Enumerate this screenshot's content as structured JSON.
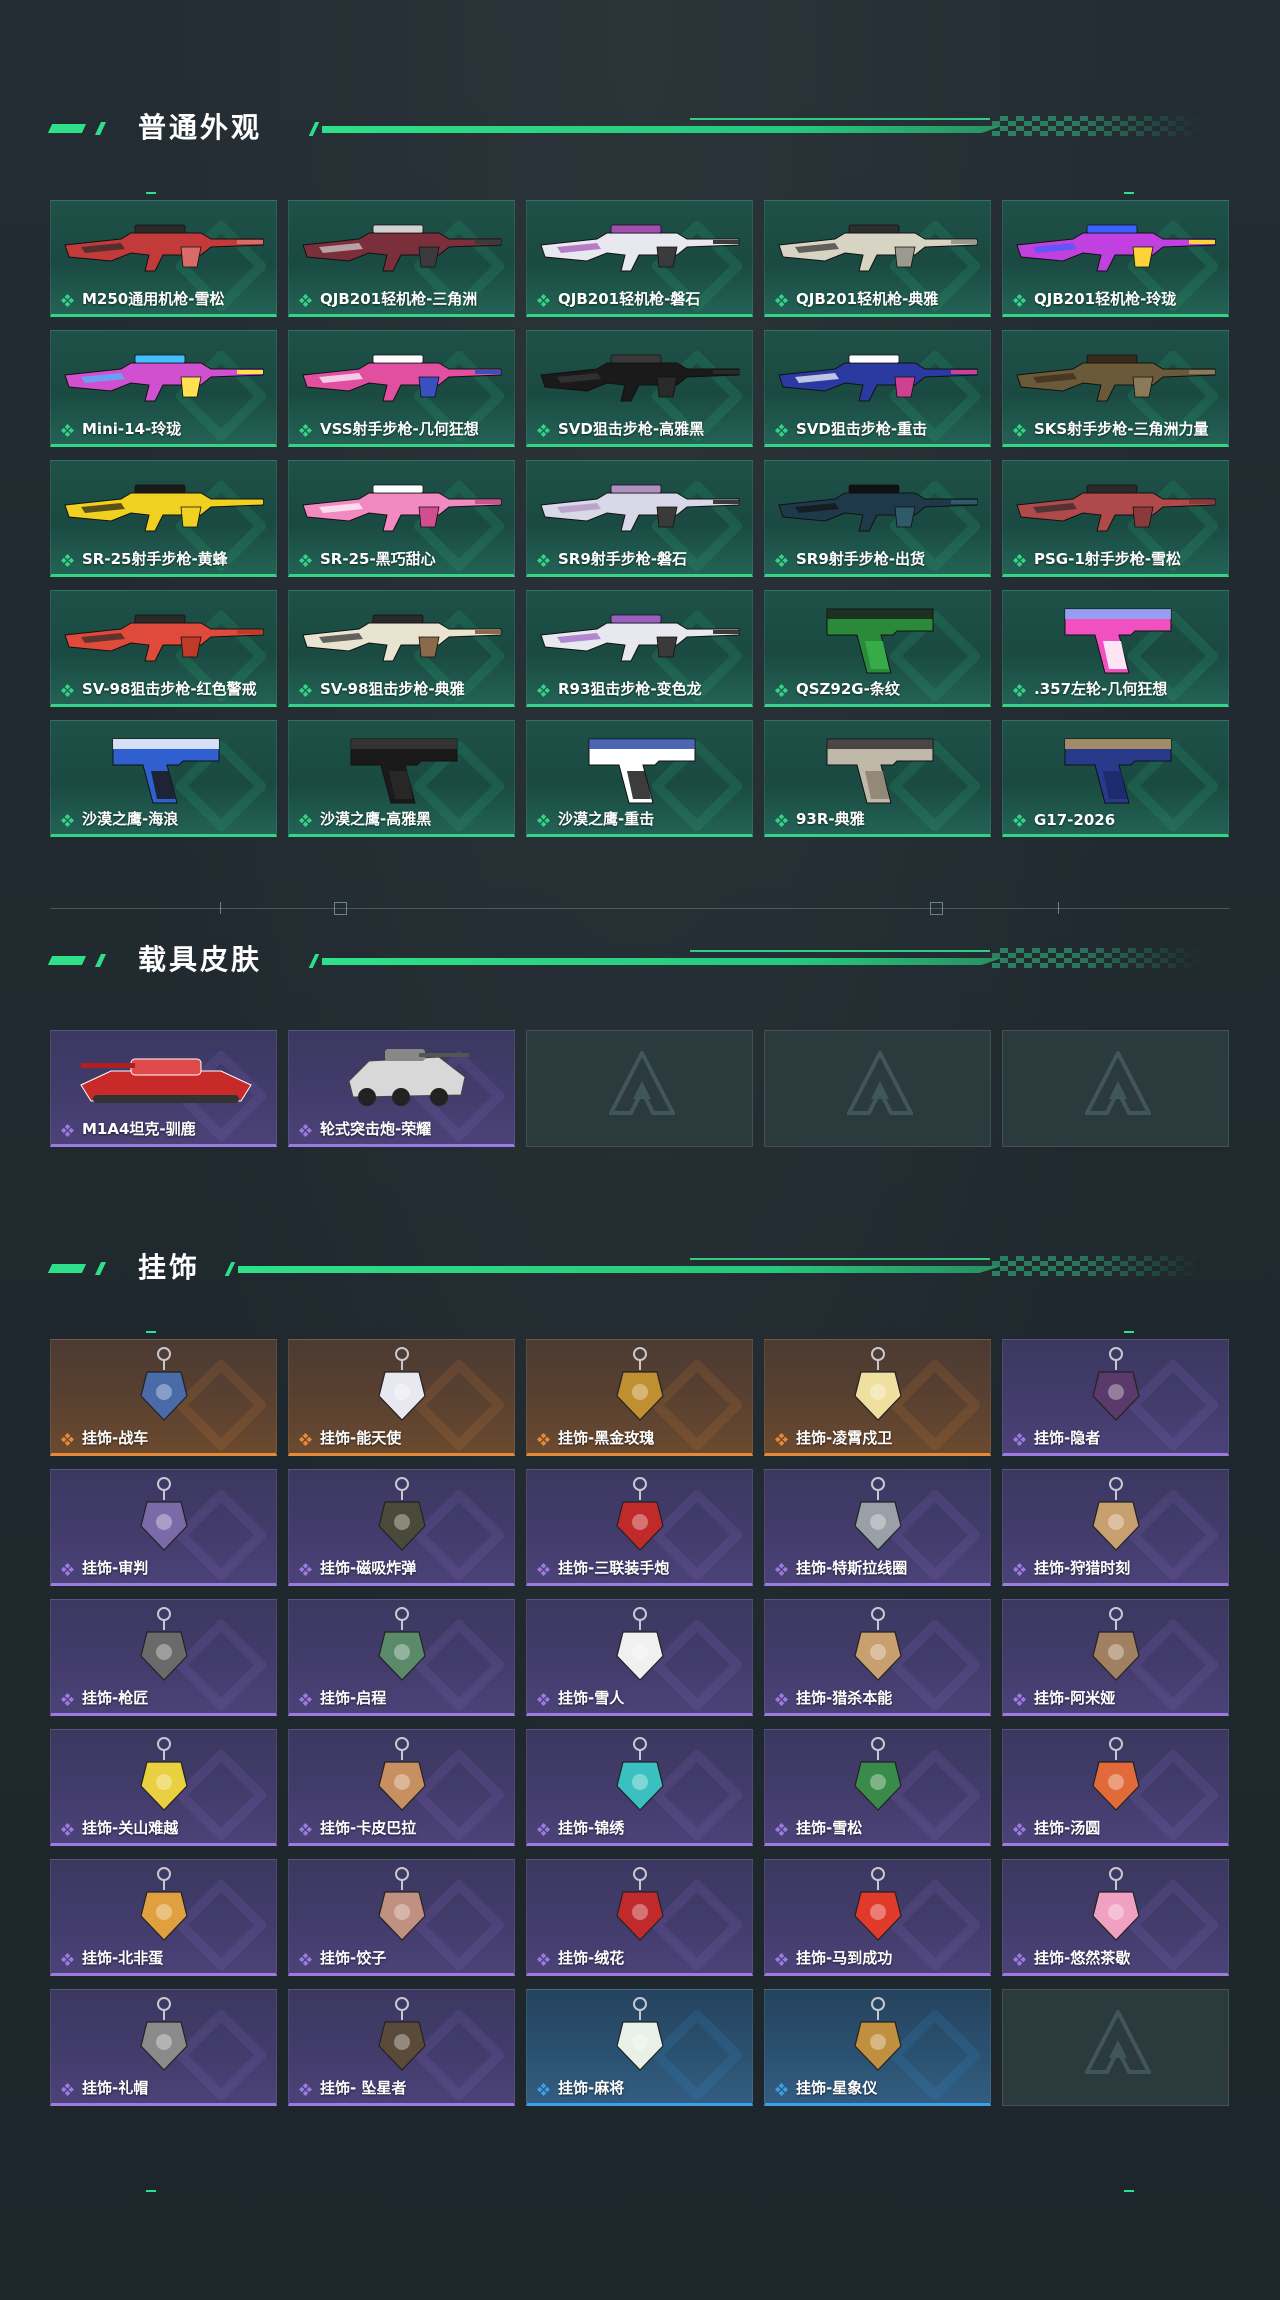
{
  "sections": {
    "skins": {
      "title": "普通外观",
      "cards": [
        {
          "label": "M250通用机枪-雪松",
          "rarity": "green",
          "art": "rifle"
        },
        {
          "label": "QJB201轻机枪-三角洲",
          "rarity": "green",
          "art": "rifle"
        },
        {
          "label": "QJB201轻机枪-磐石",
          "rarity": "green",
          "art": "rifle"
        },
        {
          "label": "QJB201轻机枪-典雅",
          "rarity": "green",
          "art": "rifle"
        },
        {
          "label": "QJB201轻机枪-玲珑",
          "rarity": "green",
          "art": "rifle"
        },
        {
          "label": "Mini-14-玲珑",
          "rarity": "green",
          "art": "rifle"
        },
        {
          "label": "VSS射手步枪-几何狂想",
          "rarity": "green",
          "art": "rifle"
        },
        {
          "label": "SVD狙击步枪-高雅黑",
          "rarity": "green",
          "art": "rifle"
        },
        {
          "label": "SVD狙击步枪-重击",
          "rarity": "green",
          "art": "rifle"
        },
        {
          "label": "SKS射手步枪-三角洲力量",
          "rarity": "green",
          "art": "rifle"
        },
        {
          "label": "SR-25射手步枪-黄蜂",
          "rarity": "green",
          "art": "rifle"
        },
        {
          "label": "SR-25-黑巧甜心",
          "rarity": "green",
          "art": "rifle"
        },
        {
          "label": "SR9射手步枪-磐石",
          "rarity": "green",
          "art": "rifle"
        },
        {
          "label": "SR9射手步枪-出货",
          "rarity": "green",
          "art": "rifle"
        },
        {
          "label": "PSG-1射手步枪-雪松",
          "rarity": "green",
          "art": "rifle"
        },
        {
          "label": "SV-98狙击步枪-红色警戒",
          "rarity": "green",
          "art": "rifle"
        },
        {
          "label": "SV-98狙击步枪-典雅",
          "rarity": "green",
          "art": "rifle"
        },
        {
          "label": "R93狙击步枪-变色龙",
          "rarity": "green",
          "art": "rifle"
        },
        {
          "label": "QSZ92G-条纹",
          "rarity": "green",
          "art": "pistol"
        },
        {
          "label": ".357左轮-几何狂想",
          "rarity": "green",
          "art": "pistol"
        },
        {
          "label": "沙漠之鹰-海浪",
          "rarity": "green",
          "art": "pistol"
        },
        {
          "label": "沙漠之鹰-高雅黑",
          "rarity": "green",
          "art": "pistol"
        },
        {
          "label": "沙漠之鹰-重击",
          "rarity": "green",
          "art": "pistol"
        },
        {
          "label": "93R-典雅",
          "rarity": "green",
          "art": "pistol"
        },
        {
          "label": "G17-2026",
          "rarity": "green",
          "art": "pistol"
        }
      ]
    },
    "vehicles": {
      "title": "载具皮肤",
      "cards": [
        {
          "label": "M1A4坦克-驯鹿",
          "rarity": "purple",
          "art": "vehicle"
        },
        {
          "label": "轮式突击炮-荣耀",
          "rarity": "purple",
          "art": "vehicle"
        },
        {
          "label": "",
          "rarity": "empty",
          "art": "none"
        },
        {
          "label": "",
          "rarity": "empty",
          "art": "none"
        },
        {
          "label": "",
          "rarity": "empty",
          "art": "none"
        }
      ]
    },
    "charms": {
      "title": "挂饰",
      "cards": [
        {
          "label": "挂饰-战车",
          "rarity": "orange",
          "art": "charm"
        },
        {
          "label": "挂饰-能天使",
          "rarity": "orange",
          "art": "charm"
        },
        {
          "label": "挂饰-黑金玫瑰",
          "rarity": "orange",
          "art": "charm"
        },
        {
          "label": "挂饰-凌霄戍卫",
          "rarity": "orange",
          "art": "charm"
        },
        {
          "label": "挂饰-隐者",
          "rarity": "purple",
          "art": "charm"
        },
        {
          "label": "挂饰-审判",
          "rarity": "purple",
          "art": "charm"
        },
        {
          "label": "挂饰-磁吸炸弹",
          "rarity": "purple",
          "art": "charm"
        },
        {
          "label": "挂饰-三联装手炮",
          "rarity": "purple",
          "art": "charm"
        },
        {
          "label": "挂饰-特斯拉线圈",
          "rarity": "purple",
          "art": "charm"
        },
        {
          "label": "挂饰-狩猎时刻",
          "rarity": "purple",
          "art": "charm"
        },
        {
          "label": "挂饰-枪匠",
          "rarity": "purple",
          "art": "charm"
        },
        {
          "label": "挂饰-启程",
          "rarity": "purple",
          "art": "charm"
        },
        {
          "label": "挂饰-雪人",
          "rarity": "purple",
          "art": "charm"
        },
        {
          "label": "挂饰-猎杀本能",
          "rarity": "purple",
          "art": "charm"
        },
        {
          "label": "挂饰-阿米娅",
          "rarity": "purple",
          "art": "charm"
        },
        {
          "label": "挂饰-关山难越",
          "rarity": "purple",
          "art": "charm"
        },
        {
          "label": "挂饰-卡皮巴拉",
          "rarity": "purple",
          "art": "charm"
        },
        {
          "label": "挂饰-锦绣",
          "rarity": "purple",
          "art": "charm"
        },
        {
          "label": "挂饰-雪松",
          "rarity": "purple",
          "art": "charm"
        },
        {
          "label": "挂饰-汤圆",
          "rarity": "purple",
          "art": "charm"
        },
        {
          "label": "挂饰-北非蛋",
          "rarity": "purple",
          "art": "charm"
        },
        {
          "label": "挂饰-饺子",
          "rarity": "purple",
          "art": "charm"
        },
        {
          "label": "挂饰-绒花",
          "rarity": "purple",
          "art": "charm"
        },
        {
          "label": "挂饰-马到成功",
          "rarity": "purple",
          "art": "charm"
        },
        {
          "label": "挂饰-悠然茶歇",
          "rarity": "purple",
          "art": "charm"
        },
        {
          "label": "挂饰-礼帽",
          "rarity": "purple",
          "art": "charm"
        },
        {
          "label": "挂饰- 坠星者",
          "rarity": "purple",
          "art": "charm"
        },
        {
          "label": "挂饰-麻将",
          "rarity": "blue",
          "art": "charm"
        },
        {
          "label": "挂饰-星象仪",
          "rarity": "blue",
          "art": "charm"
        },
        {
          "label": "",
          "rarity": "empty",
          "art": "none"
        }
      ]
    }
  },
  "colors": {
    "accent": "#2fe08a",
    "green": "#33d485",
    "purple": "#9d79e0",
    "orange": "#e58a39",
    "blue": "#3aa0e8"
  },
  "icons": {
    "rarity": "diamond-cluster-icon",
    "placeholder": "triangle-logo-icon"
  }
}
